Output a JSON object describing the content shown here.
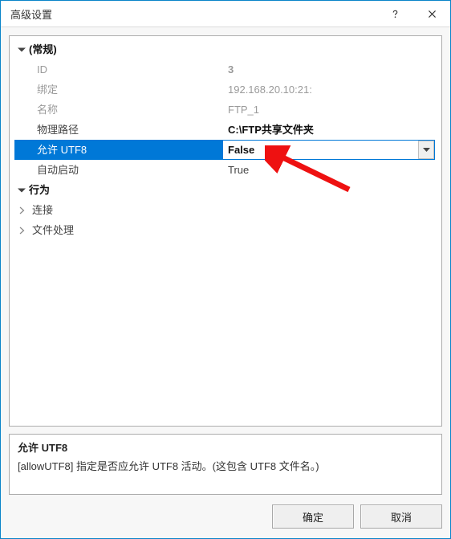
{
  "title": "高级设置",
  "categories": {
    "general": "(常规)",
    "behavior": "行为",
    "connection": "连接",
    "fileProcessing": "文件处理"
  },
  "props": {
    "id": {
      "label": "ID",
      "value": "3"
    },
    "binding": {
      "label": "绑定",
      "value": "192.168.20.10:21:"
    },
    "name": {
      "label": "名称",
      "value": "FTP_1"
    },
    "physicalPath": {
      "label": "物理路径",
      "value": "C:\\FTP共享文件夹"
    },
    "allowUtf8": {
      "label": "允许 UTF8",
      "value": "False"
    },
    "autoStart": {
      "label": "自动启动",
      "value": "True"
    }
  },
  "description": {
    "name": "允许 UTF8",
    "text": "[allowUTF8] 指定是否应允许 UTF8 活动。(这包含 UTF8 文件名。)"
  },
  "buttons": {
    "ok": "确定",
    "cancel": "取消"
  }
}
